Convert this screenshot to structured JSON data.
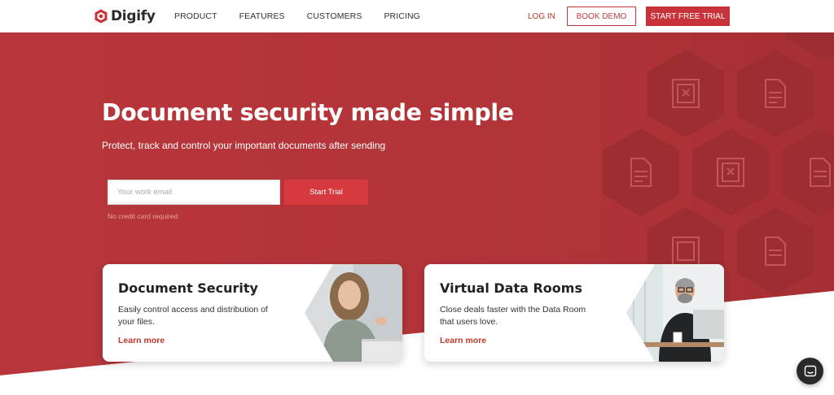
{
  "brand": {
    "name": "Digify",
    "accent": "#c8323a"
  },
  "nav": {
    "items": [
      {
        "label": "PRODUCT"
      },
      {
        "label": "FEATURES"
      },
      {
        "label": "CUSTOMERS"
      },
      {
        "label": "PRICING"
      }
    ],
    "login": "LOG IN",
    "book_demo": "BOOK DEMO",
    "start_free_trial": "START FREE TRIAL"
  },
  "hero": {
    "title": "Document security made simple",
    "subtitle": "Protect, track and control your important documents after sending",
    "email_placeholder": "Your work email",
    "email_value": "",
    "cta": "Start Trial",
    "note": "No credit card required",
    "bg_color": "#b5353a"
  },
  "cards": [
    {
      "title": "Document Security",
      "desc": "Easily control access and distribution of your files.",
      "link": "Learn more"
    },
    {
      "title": "Virtual Data Rooms",
      "desc": "Close deals faster with the Data Room that users love.",
      "link": "Learn more"
    }
  ],
  "chat": {
    "icon": "chat-icon"
  }
}
